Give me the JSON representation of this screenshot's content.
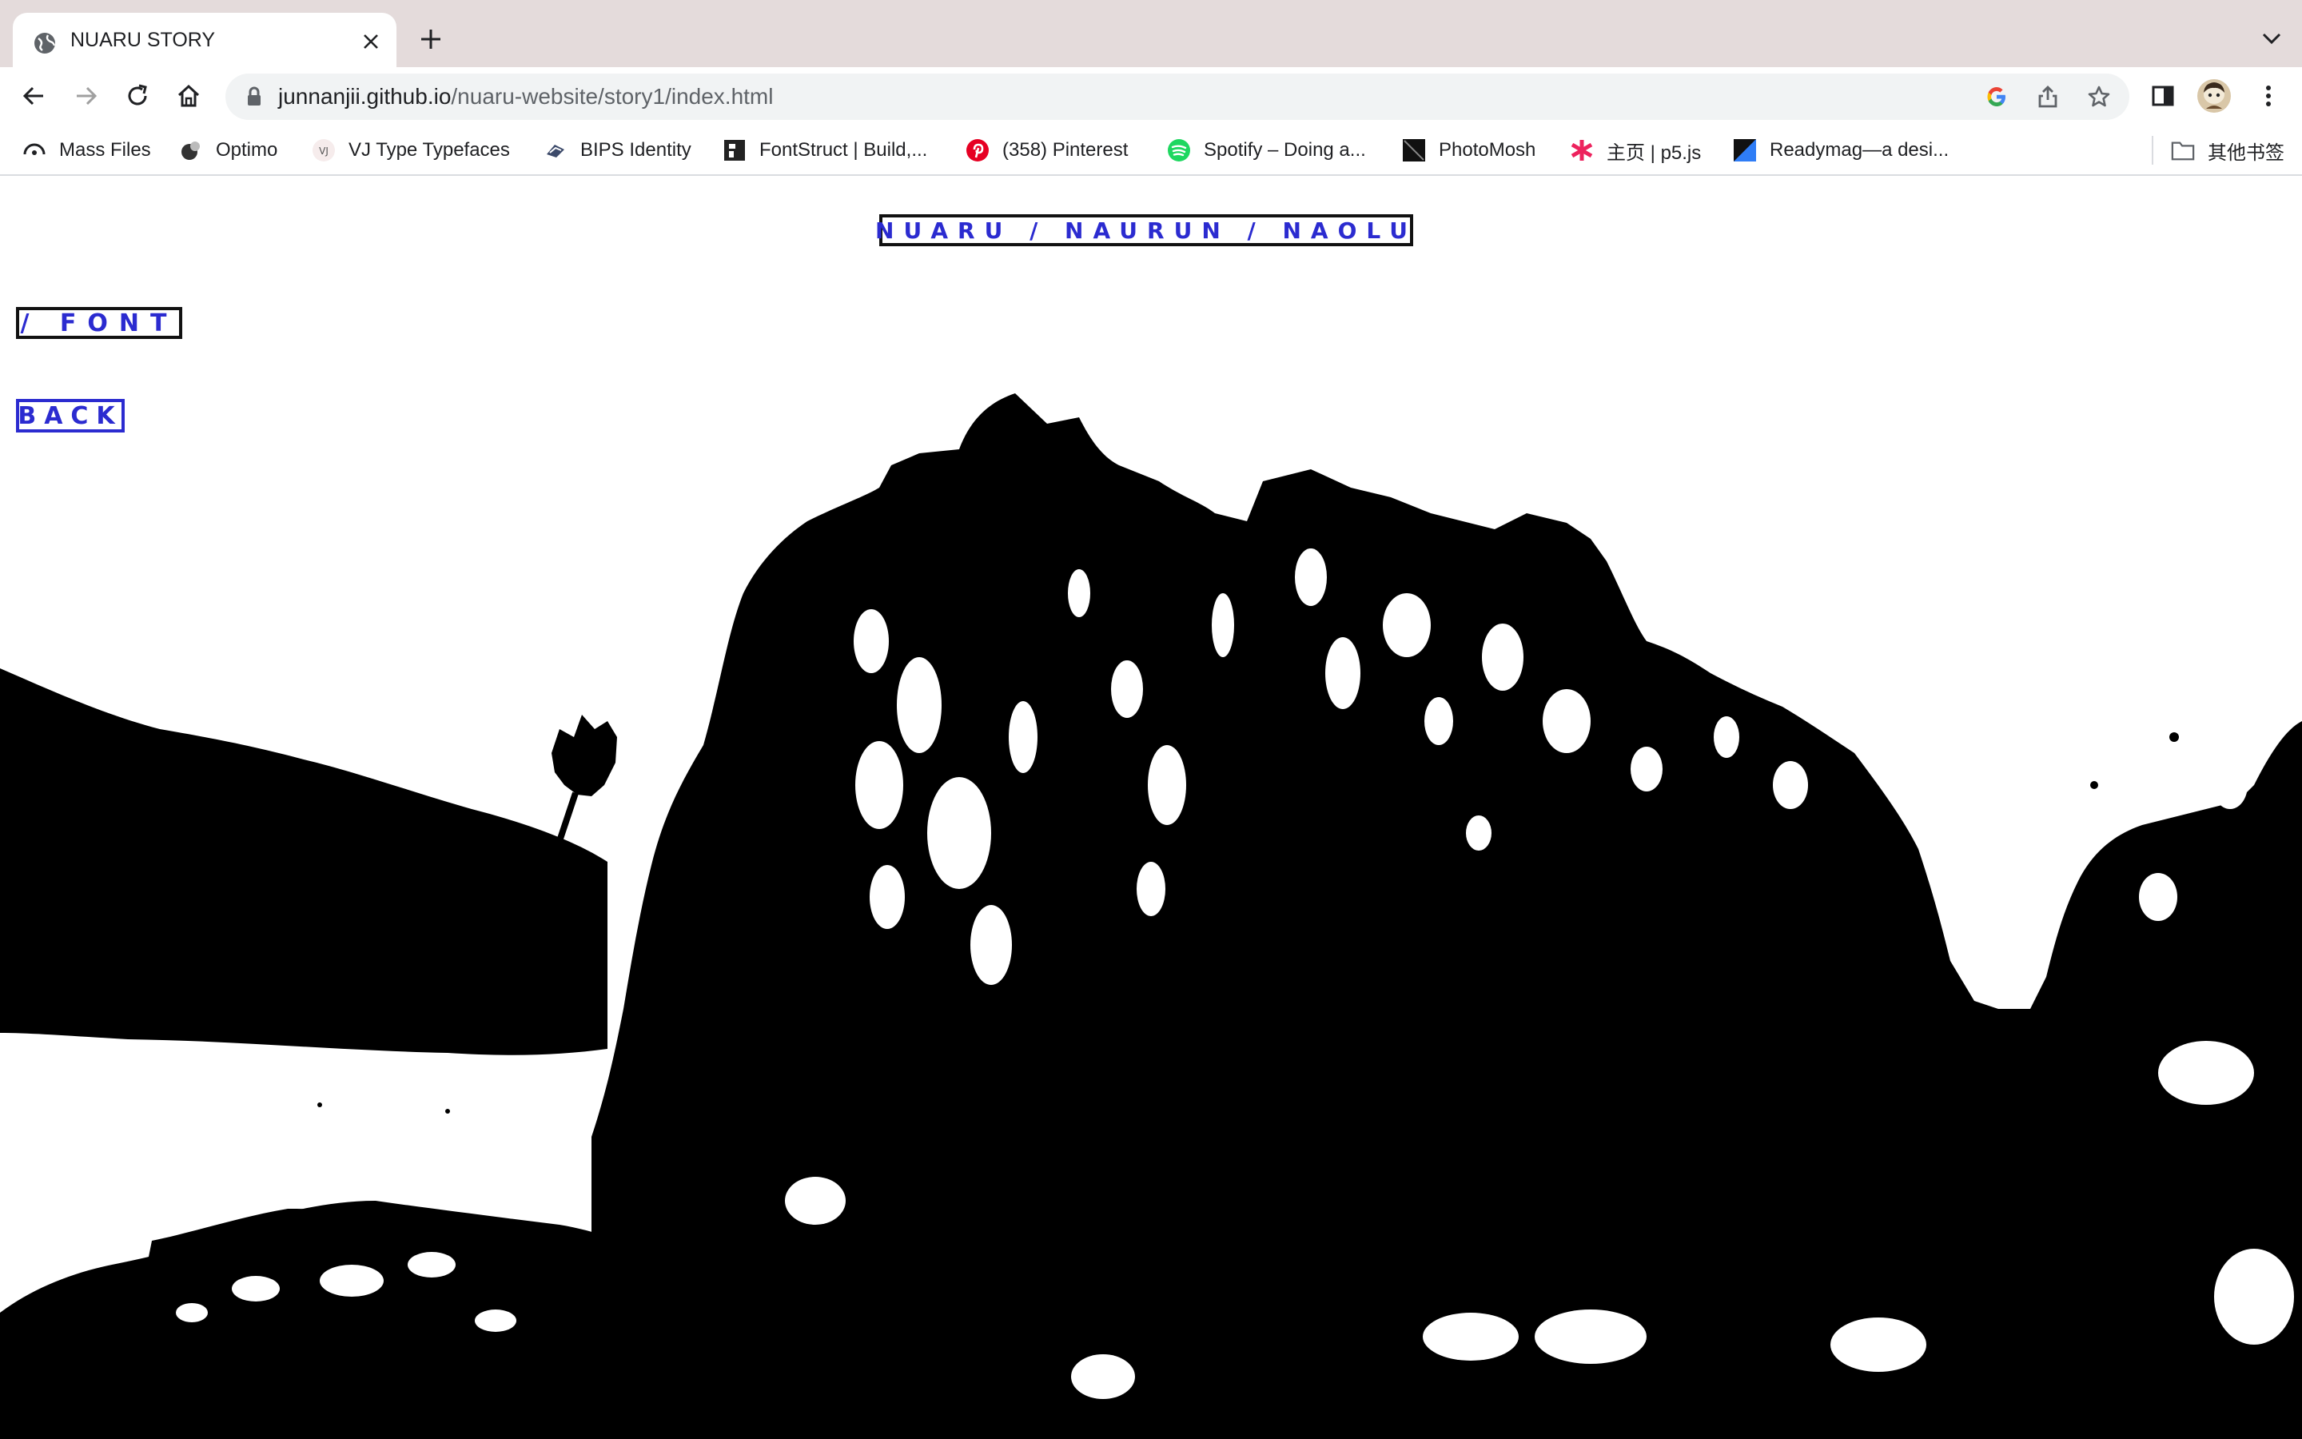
{
  "browser": {
    "tab": {
      "title": "NUARU STORY"
    },
    "address": {
      "host": "junnanjii.github.io",
      "path": "/nuaru-website/story1/index.html"
    },
    "bookmarks": [
      {
        "label": "Mass Files",
        "icon": "mass-files-icon"
      },
      {
        "label": "Optimo",
        "icon": "optimo-icon"
      },
      {
        "label": "VJ Type Typefaces",
        "icon": "vj-icon"
      },
      {
        "label": "BIPS Identity",
        "icon": "bips-icon"
      },
      {
        "label": "FontStruct | Build,...",
        "icon": "fontstruct-icon"
      },
      {
        "label": "(358) Pinterest",
        "icon": "pinterest-icon"
      },
      {
        "label": "Spotify – Doing a...",
        "icon": "spotify-icon"
      },
      {
        "label": "PhotoMosh",
        "icon": "photomosh-icon"
      },
      {
        "label": "主页 | p5.js",
        "icon": "p5js-icon"
      },
      {
        "label": "Readymag—a desi...",
        "icon": "readymag-icon"
      }
    ],
    "other_bookmarks": "其他书签",
    "colors": {
      "tabstrip": "#e4dbdb",
      "link_blue": "#2b2bd0"
    }
  },
  "page": {
    "title_link": "NUARU / NAURUN / NAOLU",
    "font_link": "/ FONT",
    "back_link": "BACK"
  }
}
